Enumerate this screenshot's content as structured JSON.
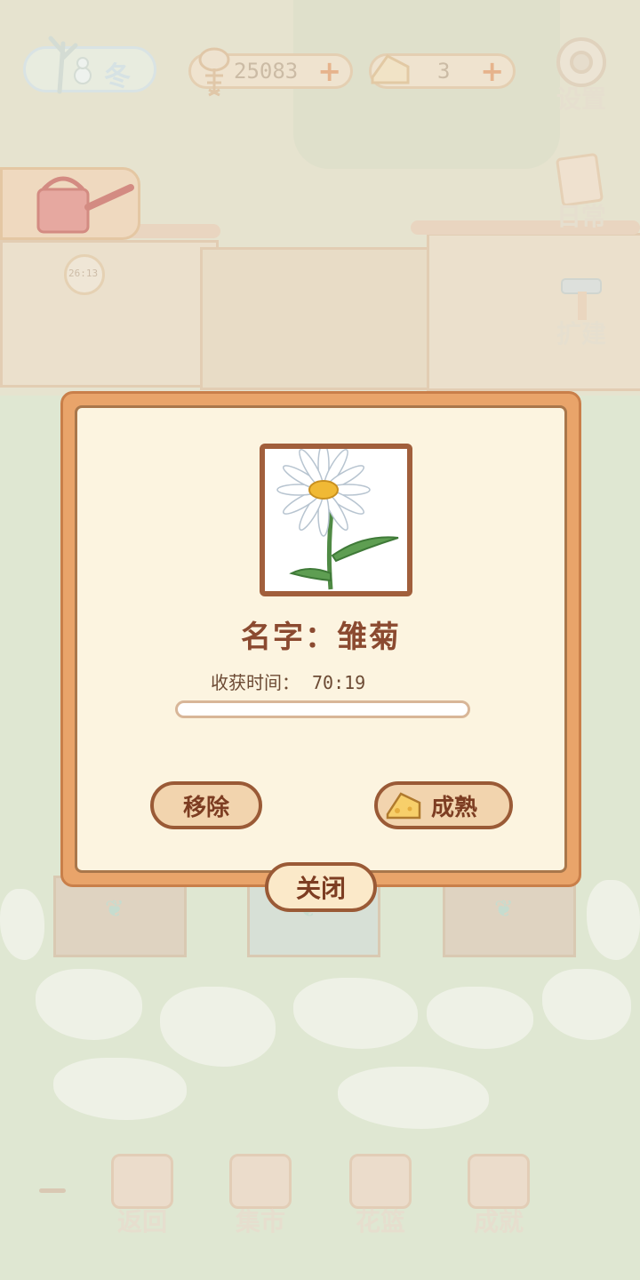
{
  "hud": {
    "season_label": "冬",
    "fish_coins": "25083",
    "cheese_count": "3"
  },
  "side_menu": {
    "settings_label": "设置",
    "daily_label": "日常",
    "expand_label": "扩建"
  },
  "timer_small": "26:13",
  "bottom_nav": {
    "back_label": "返回",
    "market_label": "集市",
    "basket_label": "花篮",
    "achievement_label": "成就"
  },
  "modal": {
    "name_text": "名字：雏菊",
    "harvest_label": "收获时间：",
    "harvest_time": "70:19",
    "progress_fraction": 0.0,
    "remove_label": "移除",
    "ripen_label": "成熟",
    "close_label": "关闭"
  },
  "colors": {
    "modal_border": "#e9a46a",
    "modal_bg": "#fcf4e0",
    "button_text": "#7d3d22"
  }
}
